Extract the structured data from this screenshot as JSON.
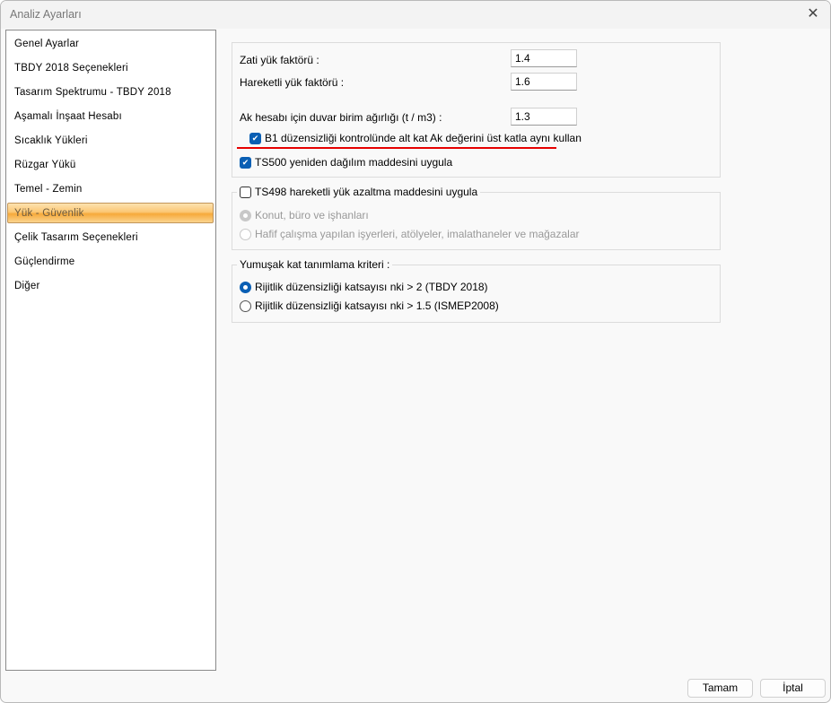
{
  "window": {
    "title": "Analiz Ayarları",
    "close_icon": "close-icon"
  },
  "sidebar": {
    "selected_index": 7,
    "items": [
      {
        "label": "Genel Ayarlar"
      },
      {
        "label": "TBDY 2018 Seçenekleri"
      },
      {
        "label": "Tasarım Spektrumu - TBDY 2018"
      },
      {
        "label": "Aşamalı İnşaat Hesabı"
      },
      {
        "label": "Sıcaklık Yükleri"
      },
      {
        "label": "Rüzgar Yükü"
      },
      {
        "label": "Temel - Zemin"
      },
      {
        "label": "Yük - Güvenlik"
      },
      {
        "label": "Çelik Tasarım Seçenekleri"
      },
      {
        "label": "Güçlendirme"
      },
      {
        "label": "Diğer"
      }
    ]
  },
  "factors": {
    "dead_label": "Zati yük faktörü :",
    "dead_value": "1.4",
    "live_label": "Hareketli yük faktörü :",
    "live_value": "1.6",
    "wall_label": "Ak hesabı için duvar birim ağırlığı (t / m3) :",
    "wall_value": "1.3",
    "b1_label": "B1 düzensizliği kontrolünde alt kat Ak değerini üst katla aynı kullan",
    "b1_checked": true,
    "ts500_label": "TS500 yeniden dağılım maddesini uygula",
    "ts500_checked": true
  },
  "ts498": {
    "label": "TS498 hareketli yük azaltma maddesini uygula",
    "checked": false,
    "options": [
      {
        "label": "Konut, büro ve işhanları",
        "selected": true,
        "disabled": true
      },
      {
        "label": "Hafif çalışma yapılan işyerleri, atölyeler, imalathaneler ve mağazalar",
        "selected": false,
        "disabled": true
      }
    ]
  },
  "soft_story": {
    "label": "Yumuşak kat tanımlama kriteri :",
    "options": [
      {
        "label": "Rijitlik düzensizliği katsayısı nki > 2 (TBDY 2018)",
        "selected": true
      },
      {
        "label": "Rijitlik düzensizliği katsayısı nki > 1.5 (ISMEP2008)",
        "selected": false
      }
    ]
  },
  "buttons": {
    "ok": "Tamam",
    "cancel": "İptal"
  },
  "colors": {
    "accent": "#0a5fb4",
    "selection": "#fbc774",
    "annotation": "#e60000"
  }
}
